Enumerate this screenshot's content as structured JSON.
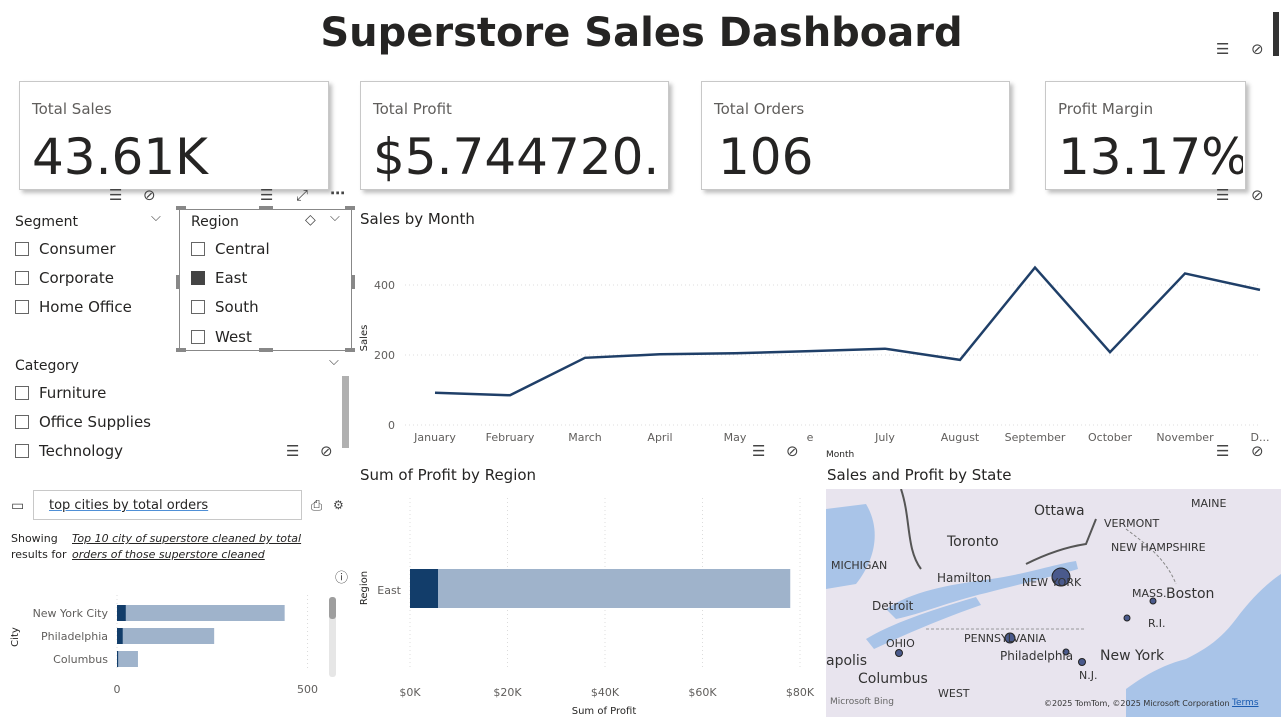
{
  "header": {
    "title": "Superstore Sales Dashboard"
  },
  "kpis": [
    {
      "label": "Total Sales",
      "value": "43.61K"
    },
    {
      "label": "Total Profit",
      "value": "$5.744720..."
    },
    {
      "label": "Total Orders",
      "value": "106"
    },
    {
      "label": "Profit Margin",
      "value": "13.17%"
    }
  ],
  "segment_slicer": {
    "title": "Segment",
    "options": [
      {
        "label": "Consumer",
        "checked": false
      },
      {
        "label": "Corporate",
        "checked": false
      },
      {
        "label": "Home Office",
        "checked": false
      }
    ]
  },
  "region_slicer": {
    "title": "Region",
    "options": [
      {
        "label": "Central",
        "checked": false
      },
      {
        "label": "East",
        "checked": true
      },
      {
        "label": "South",
        "checked": false
      },
      {
        "label": "West",
        "checked": false
      }
    ]
  },
  "category_slicer": {
    "title": "Category",
    "options": [
      {
        "label": "Furniture",
        "checked": false
      },
      {
        "label": "Office Supplies",
        "checked": false
      },
      {
        "label": "Technology",
        "checked": false
      }
    ]
  },
  "qa": {
    "query": "top cities by total orders",
    "showing_label": "Showing results for",
    "showing_link": "Top 10 city of superstore cleaned by total orders of those superstore cleaned"
  },
  "colors": {
    "dark_blue": "#123d6a",
    "light_blue": "#9fb3cb",
    "line": "#1f3f68"
  },
  "chart_data": [
    {
      "type": "line",
      "title": "Sales by Month",
      "xlabel": "Month",
      "ylabel": "Sales",
      "x_tick_labels": [
        "January",
        "February",
        "March",
        "April",
        "May",
        "e",
        "July",
        "August",
        "September",
        "October",
        "November",
        "D..."
      ],
      "x": [
        "January",
        "February",
        "March",
        "April",
        "May",
        "June",
        "July",
        "August",
        "September",
        "October",
        "November",
        "December"
      ],
      "y": [
        92,
        85,
        192,
        202,
        205,
        211,
        218,
        186,
        450,
        208,
        433,
        386
      ],
      "ylim": [
        0,
        500
      ],
      "yticks": [
        0,
        200,
        400
      ],
      "grid": true
    },
    {
      "type": "bar",
      "orientation": "horizontal",
      "title": "Sum of Profit by Region",
      "xlabel": "Sum of Profit",
      "ylabel": "Region",
      "categories": [
        "East"
      ],
      "series": [
        {
          "values": [
            5745
          ]
        },
        {
          "values": [
            78000
          ]
        }
      ],
      "xlim": [
        0,
        80000
      ],
      "xticks": [
        "$0K",
        "$20K",
        "$40K",
        "$60K",
        "$80K"
      ],
      "xtick_values": [
        0,
        20000,
        40000,
        60000,
        80000
      ]
    },
    {
      "type": "bar",
      "orientation": "horizontal",
      "title": "",
      "ylabel": "City",
      "categories": [
        "New York City",
        "Philadelphia",
        "Columbus"
      ],
      "series": [
        {
          "values": [
            23,
            15,
            3
          ]
        },
        {
          "values": [
            440,
            255,
            55
          ]
        }
      ],
      "xlim": [
        0,
        580
      ],
      "xticks": [
        "0",
        "500"
      ],
      "xtick_values": [
        0,
        500
      ]
    }
  ],
  "map": {
    "title": "Sales and Profit by State",
    "labels": [
      "Ottawa",
      "VERMONT",
      "MAINE",
      "Toronto",
      "NEW HAMPSHIRE",
      "MICHIGAN",
      "Hamilton",
      "NEW YORK",
      "MASS.",
      "Boston",
      "Detroit",
      "R.I.",
      "OHIO",
      "PENNSYLVANIA",
      "Philadelphia",
      "New York",
      "apolis",
      "Columbus",
      "N.J.",
      "WEST"
    ],
    "attribution": "©2025 TomTom, ©2025 Microsoft Corporation",
    "terms": "Terms",
    "bing": "Microsoft Bing"
  }
}
